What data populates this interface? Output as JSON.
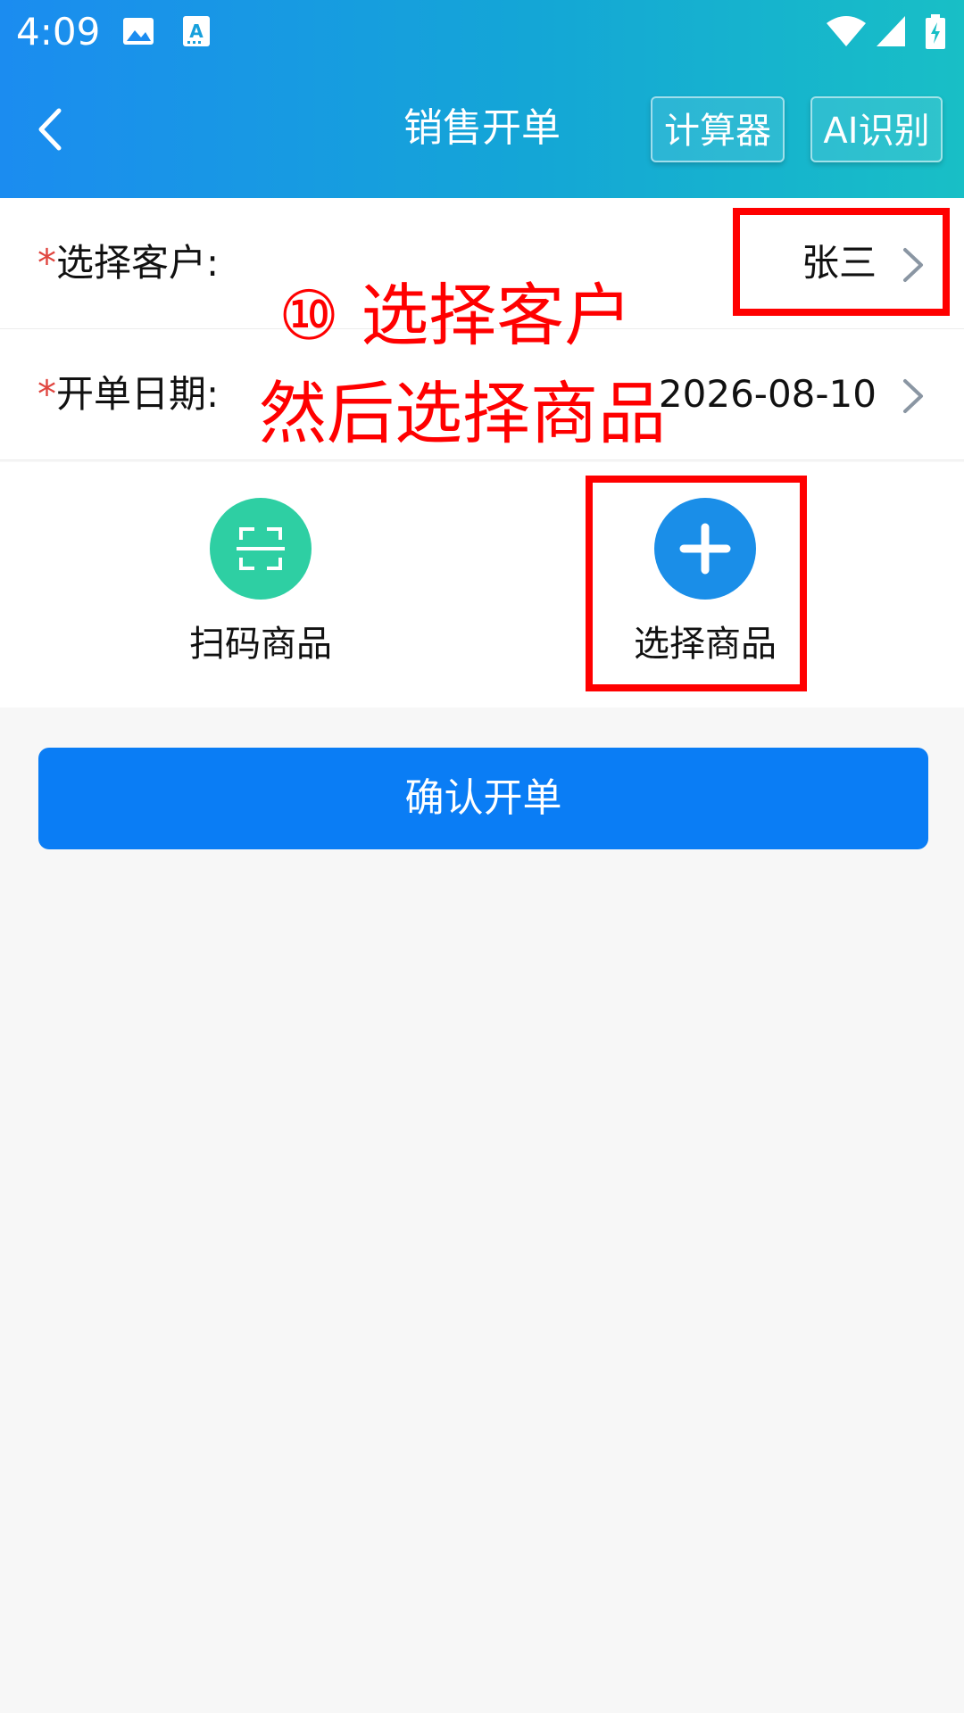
{
  "status_bar": {
    "time": "4:09",
    "icons": [
      "image-icon",
      "text-recognition-icon",
      "wifi-icon",
      "cell-signal-icon",
      "battery-charging-icon"
    ]
  },
  "header": {
    "title": "销售开单",
    "calculator_label": "计算器",
    "ai_label": "AI识别",
    "gradient_colors": [
      "#1b8cf0",
      "#18bfc6"
    ]
  },
  "form": {
    "required_mark": "*",
    "customer": {
      "label": "选择客户:",
      "value": "张三"
    },
    "date": {
      "label": "开单日期:",
      "value": "2026-08-10"
    }
  },
  "actions": {
    "scan": {
      "label": "扫码商品",
      "icon": "scan-icon",
      "color": "#2ecfa3"
    },
    "select": {
      "label": "选择商品",
      "icon": "plus-icon",
      "color": "#1a8ee8"
    }
  },
  "confirm_label": "确认开单",
  "annotations": {
    "line1": "⑩ 选择客户",
    "line2": "然后选择商品",
    "color": "#ff0000"
  }
}
